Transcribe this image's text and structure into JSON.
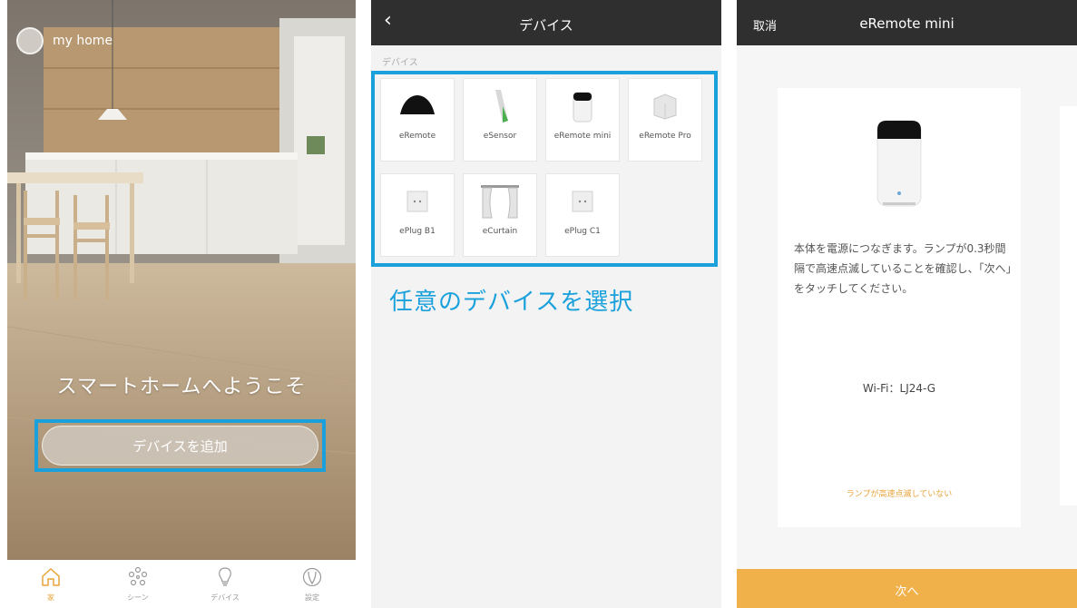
{
  "home": {
    "home_name": "my home",
    "welcome": "スマートホームへようこそ",
    "add_device": "デバイスを追加",
    "tabs": [
      {
        "label": "家",
        "icon": "home-icon",
        "active": true
      },
      {
        "label": "シーン",
        "icon": "scene-icon",
        "active": false
      },
      {
        "label": "デバイス",
        "icon": "bulb-icon",
        "active": false
      },
      {
        "label": "設定",
        "icon": "settings-icon",
        "active": false
      }
    ]
  },
  "device_list": {
    "back_icon": "back-chevron-icon",
    "title": "デバイス",
    "section": "デバイス",
    "devices": [
      {
        "label": "eRemote",
        "icon": "eremote-device-icon"
      },
      {
        "label": "eSensor",
        "icon": "esensor-device-icon"
      },
      {
        "label": "eRemote mini",
        "icon": "eremote-mini-device-icon"
      },
      {
        "label": "eRemote Pro",
        "icon": "eremote-pro-device-icon"
      },
      {
        "label": "ePlug B1",
        "icon": "eplug-device-icon"
      },
      {
        "label": "eCurtain",
        "icon": "ecurtain-device-icon"
      },
      {
        "label": "ePlug C1",
        "icon": "eplug-device-icon"
      }
    ],
    "caption": "任意のデバイスを選択"
  },
  "setup": {
    "cancel": "取消",
    "title": "eRemote mini",
    "description": "本体を電源につなぎます。ランプが0.3秒間隔で高速点滅していることを確認し、「次へ」をタッチしてください。",
    "wifi": "Wi-Fi：LJ24-G",
    "not_blinking": "ランプが高速点滅していない",
    "next": "次へ"
  },
  "colors": {
    "highlight": "#1aa1dc",
    "accent": "#f0b14a",
    "nav": "#2f2f2f"
  }
}
